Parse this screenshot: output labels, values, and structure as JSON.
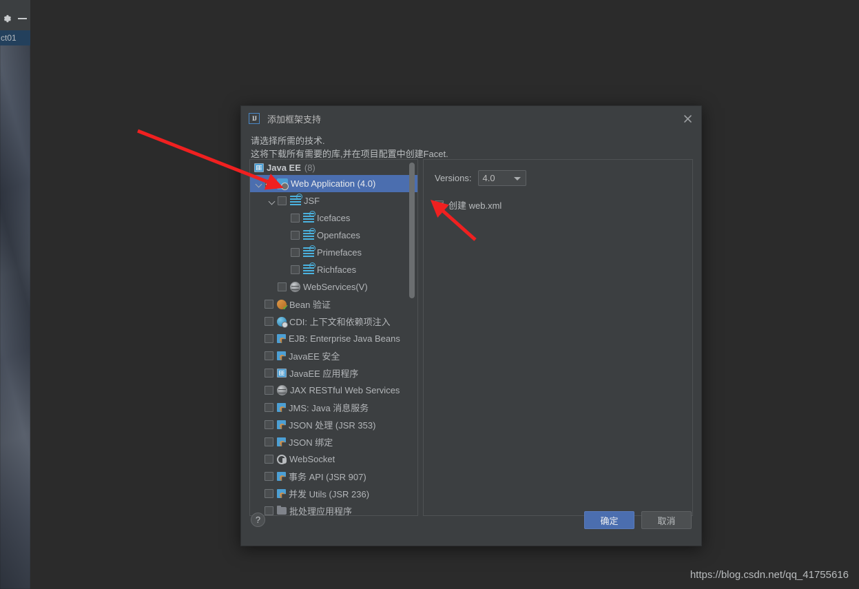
{
  "ide": {
    "tab_label": "ct01",
    "gear_icon": "gear-icon",
    "minimize_icon": "minimize-icon"
  },
  "dialog": {
    "title": "添加框架支持",
    "title_icon": "IJ",
    "close_icon": "close-icon",
    "description_line1": "请选择所需的技术.",
    "description_line2": "这将下载所有需要的库,并在项目配置中创建Facet."
  },
  "tree": {
    "group_label": "Java EE",
    "group_count": "(8)",
    "group_icon": "module-icon",
    "items": [
      {
        "label": "Web Application (4.0)",
        "icon": "webapp-icon",
        "indent": 0,
        "twisty": "expanded",
        "checked": true,
        "selected": true
      },
      {
        "label": "JSF",
        "icon": "jsf-icon",
        "indent": 1,
        "twisty": "expanded",
        "checked": false,
        "selected": false
      },
      {
        "label": "Icefaces",
        "icon": "jsf-icon",
        "indent": 2,
        "twisty": "none",
        "checked": false,
        "selected": false
      },
      {
        "label": "Openfaces",
        "icon": "jsf-icon",
        "indent": 2,
        "twisty": "none",
        "checked": false,
        "selected": false
      },
      {
        "label": "Primefaces",
        "icon": "jsf-icon",
        "indent": 2,
        "twisty": "none",
        "checked": false,
        "selected": false
      },
      {
        "label": "Richfaces",
        "icon": "jsf-icon",
        "indent": 2,
        "twisty": "none",
        "checked": false,
        "selected": false
      },
      {
        "label": "WebServices(V)",
        "icon": "globe-icon",
        "indent": 1,
        "twisty": "none",
        "checked": false,
        "selected": false
      },
      {
        "label": "Bean 验证",
        "icon": "bean-icon",
        "indent": 0,
        "twisty": "none",
        "checked": false,
        "selected": false
      },
      {
        "label": "CDI: 上下文和依赖项注入",
        "icon": "cdi-icon",
        "indent": 0,
        "twisty": "none",
        "checked": false,
        "selected": false
      },
      {
        "label": "EJB: Enterprise Java Beans",
        "icon": "ejb-icon",
        "indent": 0,
        "twisty": "none",
        "checked": false,
        "selected": false
      },
      {
        "label": "JavaEE 安全",
        "icon": "ejb-icon",
        "indent": 0,
        "twisty": "none",
        "checked": false,
        "selected": false
      },
      {
        "label": "JavaEE 应用程序",
        "icon": "module-icon",
        "indent": 0,
        "twisty": "none",
        "checked": false,
        "selected": false
      },
      {
        "label": "JAX RESTful Web Services",
        "icon": "globe-icon",
        "indent": 0,
        "twisty": "none",
        "checked": false,
        "selected": false
      },
      {
        "label": "JMS: Java 消息服务",
        "icon": "ejb-icon",
        "indent": 0,
        "twisty": "none",
        "checked": false,
        "selected": false
      },
      {
        "label": "JSON 处理 (JSR 353)",
        "icon": "ejb-icon",
        "indent": 0,
        "twisty": "none",
        "checked": false,
        "selected": false
      },
      {
        "label": "JSON 绑定",
        "icon": "ejb-icon",
        "indent": 0,
        "twisty": "none",
        "checked": false,
        "selected": false
      },
      {
        "label": "WebSocket",
        "icon": "socket-icon",
        "indent": 0,
        "twisty": "none",
        "checked": false,
        "selected": false
      },
      {
        "label": "事务 API (JSR 907)",
        "icon": "ejb-icon",
        "indent": 0,
        "twisty": "none",
        "checked": false,
        "selected": false
      },
      {
        "label": "并发 Utils (JSR 236)",
        "icon": "ejb-icon",
        "indent": 0,
        "twisty": "none",
        "checked": false,
        "selected": false
      },
      {
        "label": "批处理应用程序",
        "icon": "folder-icon",
        "indent": 0,
        "twisty": "none",
        "checked": false,
        "selected": false
      }
    ]
  },
  "settings": {
    "versions_label": "Versions:",
    "versions_value": "4.0",
    "versions_options": [
      "4.0"
    ],
    "create_webxml_label": "创建 web.xml",
    "create_webxml_checked": true
  },
  "footer": {
    "help_label": "?",
    "ok_label": "确定",
    "cancel_label": "取消"
  },
  "watermark": {
    "text": "https://blog.csdn.net/qq_41755616"
  },
  "colors": {
    "dialog_bg": "#3c3f41",
    "selection_blue": "#4b6eaf",
    "annotation_red": "#f02020",
    "editor_bg": "#2b2b2b"
  }
}
